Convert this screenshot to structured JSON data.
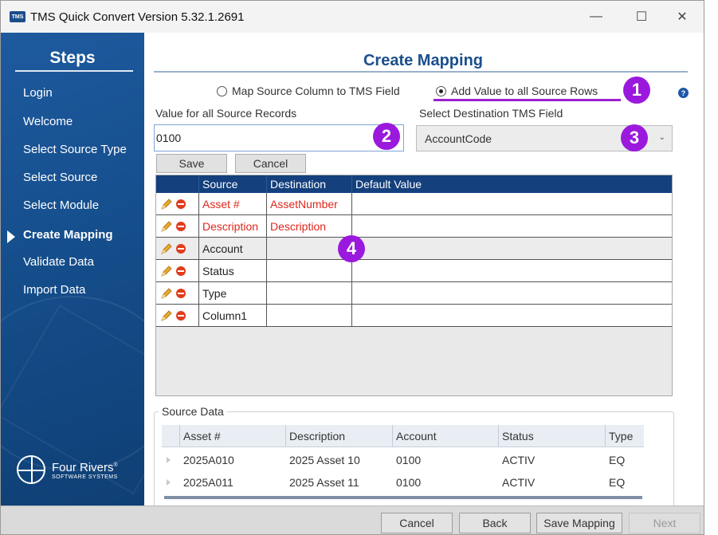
{
  "window": {
    "app_icon": "TMS",
    "title": "TMS Quick Convert Version 5.32.1.2691",
    "controls": {
      "minimize": "—",
      "maximize": "☐",
      "close": "✕"
    }
  },
  "sidebar": {
    "title": "Steps",
    "steps": [
      {
        "label": "Login",
        "active": false
      },
      {
        "label": "Welcome",
        "active": false
      },
      {
        "label": "Select Source Type",
        "active": false
      },
      {
        "label": "Select Source",
        "active": false
      },
      {
        "label": "Select Module",
        "active": false
      },
      {
        "label": "Create Mapping",
        "active": true
      },
      {
        "label": "Validate Data",
        "active": false
      },
      {
        "label": "Import Data",
        "active": false
      }
    ],
    "logo": {
      "name": "Four Rivers",
      "mark": "®",
      "sub": "SOFTWARE SYSTEMS"
    }
  },
  "main": {
    "title": "Create Mapping",
    "mode_options": [
      {
        "label": "Map Source Column to TMS Field",
        "checked": false
      },
      {
        "label": "Add Value to all Source Rows",
        "checked": true
      }
    ],
    "help_icon": "?",
    "value_label": "Value for all Source Records",
    "value": "0100",
    "dest_label": "Select Destination TMS Field",
    "dest_value": "AccountCode",
    "dest_chevron": "⌄",
    "buttons": {
      "save": "Save",
      "cancel": "Cancel"
    },
    "callouts": [
      "1",
      "2",
      "3",
      "4"
    ],
    "accent_color": "#9b19dd"
  },
  "mapping": {
    "columns": [
      "Source",
      "Destination",
      "Default Value"
    ],
    "rows": [
      {
        "source": "Asset #",
        "destination": "AssetNumber",
        "default": "",
        "highlight": true
      },
      {
        "source": "Description",
        "destination": "Description",
        "default": "",
        "highlight": true
      },
      {
        "source": "Account",
        "destination": "",
        "default": "",
        "highlight": false
      },
      {
        "source": "Status",
        "destination": "",
        "default": "",
        "highlight": false
      },
      {
        "source": "Type",
        "destination": "",
        "default": "",
        "highlight": false
      },
      {
        "source": "Column1",
        "destination": "",
        "default": "",
        "highlight": false
      }
    ]
  },
  "source_data": {
    "legend": "Source Data",
    "columns": [
      "Asset #",
      "Description",
      "Account",
      "Status",
      "Type"
    ],
    "rows": [
      [
        "2025A010",
        "2025 Asset 10",
        "0100",
        "ACTIV",
        "EQ"
      ],
      [
        "2025A011",
        "2025 Asset 11",
        "0100",
        "ACTIV",
        "EQ"
      ]
    ]
  },
  "footer": {
    "cancel": "Cancel",
    "back": "Back",
    "save_mapping": "Save Mapping",
    "next": "Next"
  }
}
